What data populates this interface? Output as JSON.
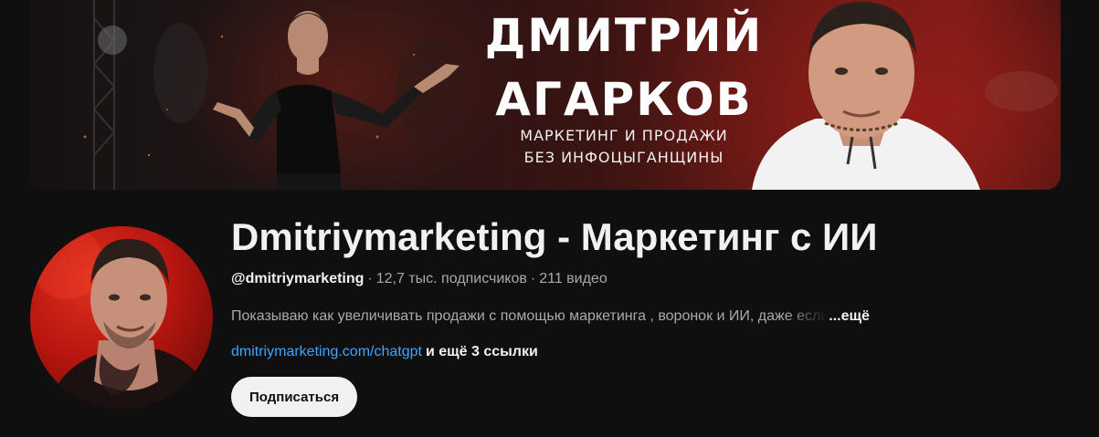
{
  "banner": {
    "title_line1": "ДМИТРИЙ",
    "title_line2": "АГАРКОВ",
    "subtitle_line1": "МАРКЕТИНГ И ПРОДАЖИ",
    "subtitle_line2": "БЕЗ ИНФОЦЫГАНЩИНЫ"
  },
  "channel": {
    "name": "Dmitriymarketing - Маркетинг с ИИ",
    "handle": "@dmitriymarketing",
    "separator": "·",
    "subscribers": "12,7 тыс. подписчиков",
    "videos": "211 видео",
    "description": "Показываю как увеличивать продажи с помощью маркетинга , воронок и ИИ, даже если",
    "description_more": "...ещё",
    "link": "dmitriymarketing.com/chatgpt",
    "more_links": "и ещё 3 ссылки",
    "subscribe_label": "Подписаться"
  },
  "colors": {
    "background": "#0f0f0f",
    "link": "#3ea6ff",
    "secondary_text": "#aaaaaa",
    "button_bg": "#f1f1f1",
    "banner_accent": "#7d1a16"
  }
}
